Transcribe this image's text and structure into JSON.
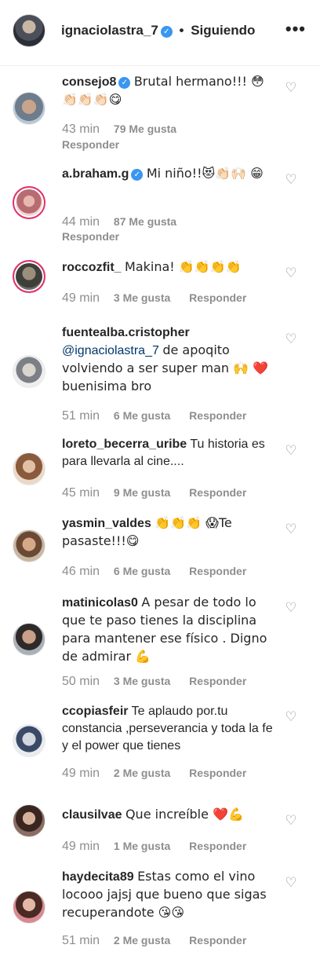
{
  "header": {
    "username": "ignaciolastra_7",
    "separator": "•",
    "following_label": "Siguiendo",
    "more_label": "•••"
  },
  "colors": {
    "text": "#262626",
    "meta": "#8e8e8e",
    "verified": "#3897f0",
    "mention": "#00376b"
  },
  "comments": [
    {
      "user": "consejo8",
      "verified": true,
      "text": "Brutal hermano!!! 😳 👏🏻👏🏻👏🏻😋",
      "time": "43 min",
      "likes": "79 Me gusta",
      "reply": "Responder"
    },
    {
      "user": "a.braham.g",
      "verified": true,
      "text": "Mi niño!!😻👏🏻🙌🏻 😁",
      "time": "44 min",
      "likes": "87 Me gusta",
      "reply": "Responder"
    },
    {
      "user": "roccozfit_",
      "verified": false,
      "text": "Makina! 👏👏👏👏",
      "time": "49 min",
      "likes": "3 Me gusta",
      "reply": "Responder"
    },
    {
      "user": "fuentealba.cristopher",
      "verified": false,
      "mention": "@ignaciolastra_7",
      "text": "de apoqito volviendo a ser super man 🙌 ❤️ buenisima bro",
      "time": "51 min",
      "likes": "6 Me gusta",
      "reply": "Responder"
    },
    {
      "user": "loreto_becerra_uribe",
      "verified": false,
      "text": "Tu historia es para llevarla al cine....",
      "time": "45 min",
      "likes": "9 Me gusta",
      "reply": "Responder"
    },
    {
      "user": "yasmin_valdes",
      "verified": false,
      "text": "👏👏👏 😱Te pasaste!!!😋",
      "time": "46 min",
      "likes": "6 Me gusta",
      "reply": "Responder"
    },
    {
      "user": "matinicolas0",
      "verified": false,
      "text": "A pesar de todo lo que te paso tienes la disciplina para mantener ese físico . Digno de admirar 💪",
      "time": "50 min",
      "likes": "3 Me gusta",
      "reply": "Responder"
    },
    {
      "user": "ccopiasfeir",
      "verified": false,
      "text": "Te aplaudo por.tu constancia ,perseverancia y toda la fe y el power que tienes",
      "time": "49 min",
      "likes": "2 Me gusta",
      "reply": "Responder"
    },
    {
      "user": "clausilvae",
      "verified": false,
      "text": "Que increíble ❤️💪",
      "time": "49 min",
      "likes": "1 Me gusta",
      "reply": "Responder"
    },
    {
      "user": "haydecita89",
      "verified": false,
      "text": "Estas como el vino locooo jajsj que bueno que sigas recuperandote 😘😘",
      "time": "51 min",
      "likes": "2 Me gusta",
      "reply": "Responder"
    }
  ]
}
